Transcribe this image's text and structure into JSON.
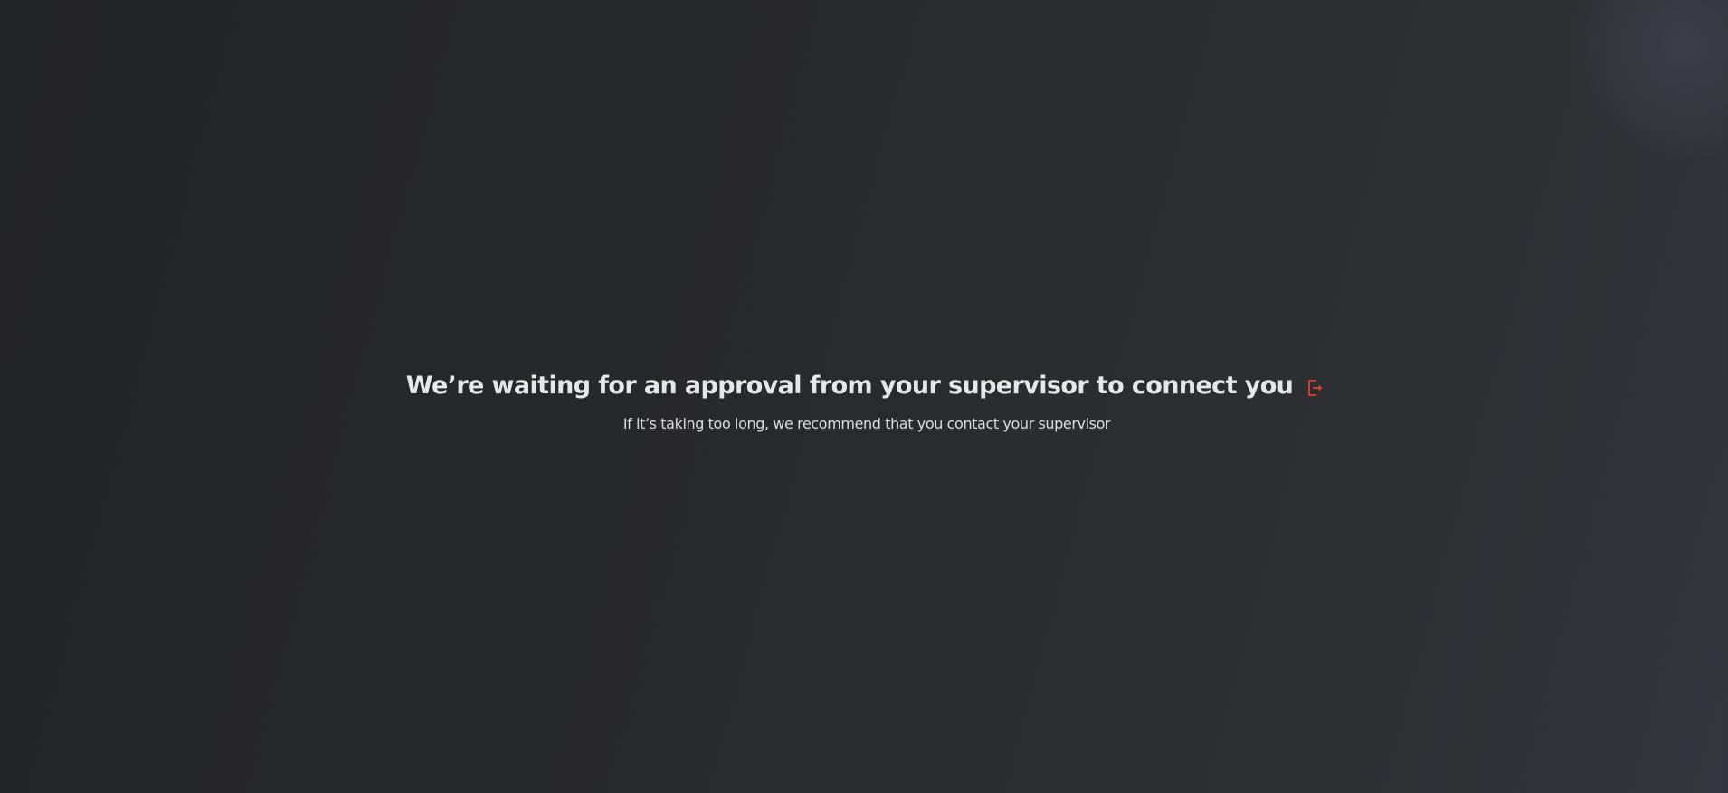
{
  "waiting": {
    "title": "We’re waiting for an approval from your supervisor to connect you",
    "subtitle": "If it’s taking too long, we recommend that you contact your supervisor",
    "logout_icon": "logout-icon"
  },
  "colors": {
    "background_dark": "#232426",
    "background_light": "#33363c",
    "text": "#e6e7e9",
    "accent": "#d9412e"
  }
}
